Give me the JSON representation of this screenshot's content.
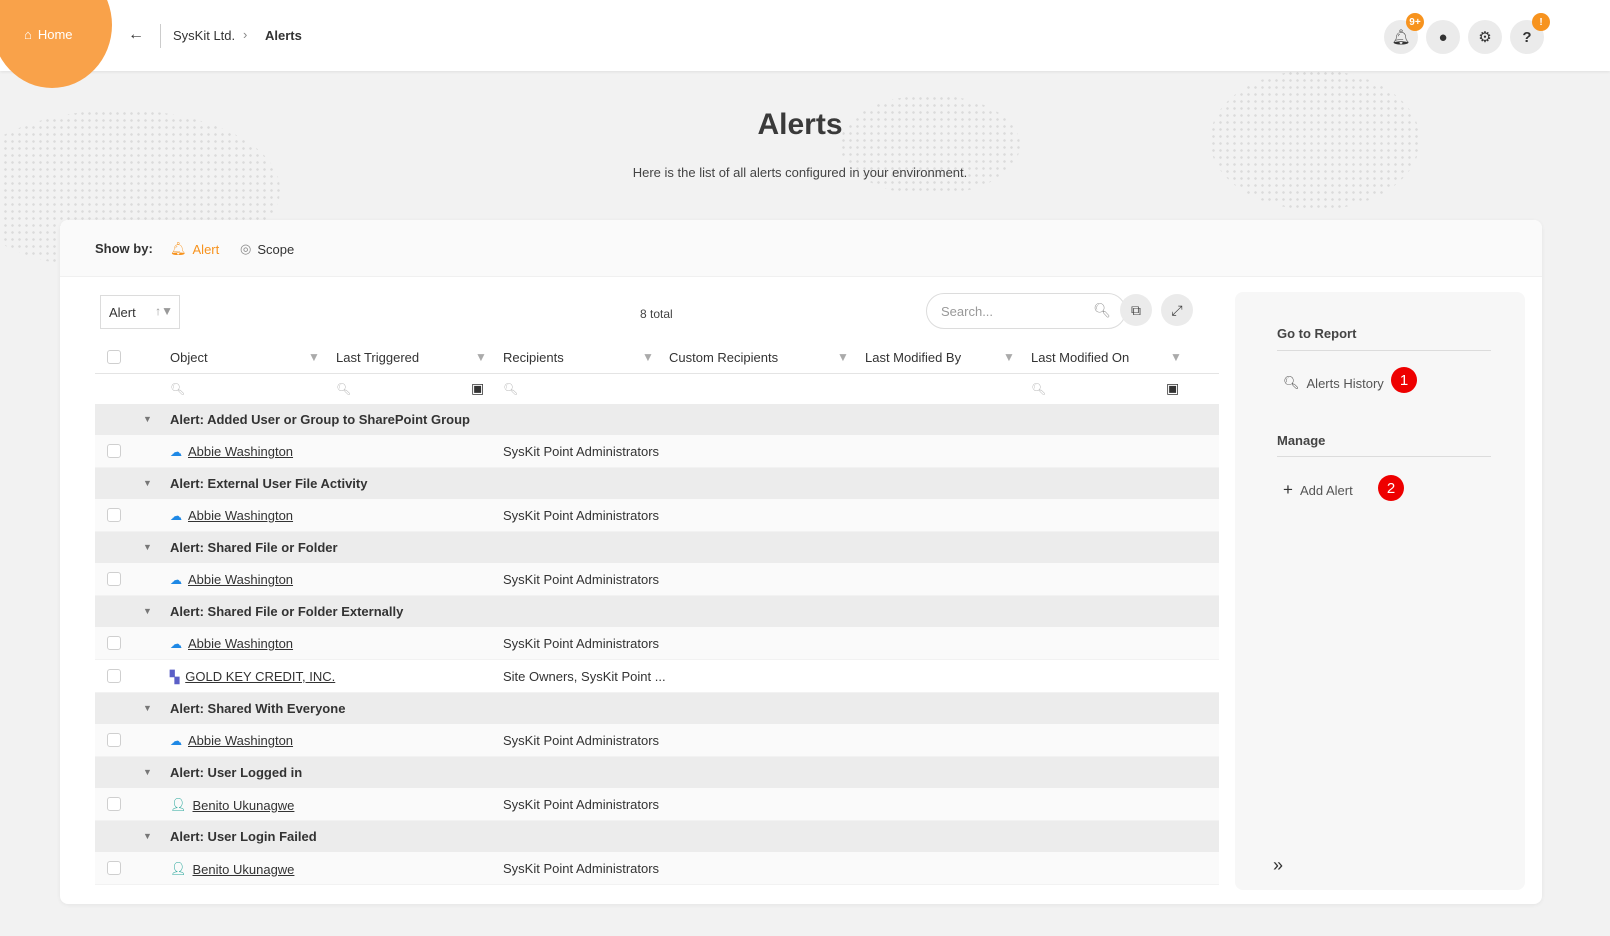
{
  "topbar": {
    "home_label": "Home",
    "breadcrumb_org": "SysKit Ltd.",
    "breadcrumb_sep": "›",
    "breadcrumb_current": "Alerts",
    "notifications_badge": "9+",
    "help_badge": "!"
  },
  "header": {
    "title": "Alerts",
    "subtitle": "Here is the list of all alerts configured in your environment."
  },
  "showby": {
    "label": "Show by:",
    "options": [
      {
        "label": "Alert",
        "active": true
      },
      {
        "label": "Scope",
        "active": false
      }
    ]
  },
  "grid": {
    "group_by": "Alert",
    "total": "8 total",
    "search_placeholder": "Search...",
    "columns": [
      "Object",
      "Last Triggered",
      "Recipients",
      "Custom Recipients",
      "Last Modified By",
      "Last Modified On"
    ],
    "groups": [
      {
        "title": "Alert: Added User or Group to SharePoint Group",
        "rows": [
          {
            "icon": "onedrive-icon",
            "object": "Abbie Washington",
            "recipients": "SysKit Point Administrators"
          }
        ]
      },
      {
        "title": "Alert: External User File Activity",
        "rows": [
          {
            "icon": "onedrive-icon",
            "object": "Abbie Washington",
            "recipients": "SysKit Point Administrators"
          }
        ]
      },
      {
        "title": "Alert: Shared File or Folder",
        "rows": [
          {
            "icon": "onedrive-icon",
            "object": "Abbie Washington",
            "recipients": "SysKit Point Administrators"
          }
        ]
      },
      {
        "title": "Alert: Shared File or Folder Externally",
        "rows": [
          {
            "icon": "onedrive-icon",
            "object": "Abbie Washington",
            "recipients": "SysKit Point Administrators"
          },
          {
            "icon": "teams-icon",
            "object": "GOLD KEY CREDIT, INC.",
            "recipients": "Site Owners, SysKit Point ..."
          }
        ]
      },
      {
        "title": "Alert: Shared With Everyone",
        "rows": [
          {
            "icon": "onedrive-icon",
            "object": "Abbie Washington",
            "recipients": "SysKit Point Administrators"
          }
        ]
      },
      {
        "title": "Alert: User Logged in",
        "rows": [
          {
            "icon": "user-icon",
            "object": "Benito Ukunagwe",
            "recipients": "SysKit Point Administrators"
          }
        ]
      },
      {
        "title": "Alert: User Login Failed",
        "rows": [
          {
            "icon": "user-icon",
            "object": "Benito Ukunagwe",
            "recipients": "SysKit Point Administrators"
          }
        ]
      }
    ]
  },
  "side": {
    "report_heading": "Go to Report",
    "alerts_history": "Alerts History",
    "badge1": "1",
    "manage_heading": "Manage",
    "add_alert": "Add Alert",
    "badge2": "2"
  },
  "colors": {
    "accent": "#f7931e",
    "home_blob": "#f9a24a",
    "step_badge": "#e00000"
  }
}
